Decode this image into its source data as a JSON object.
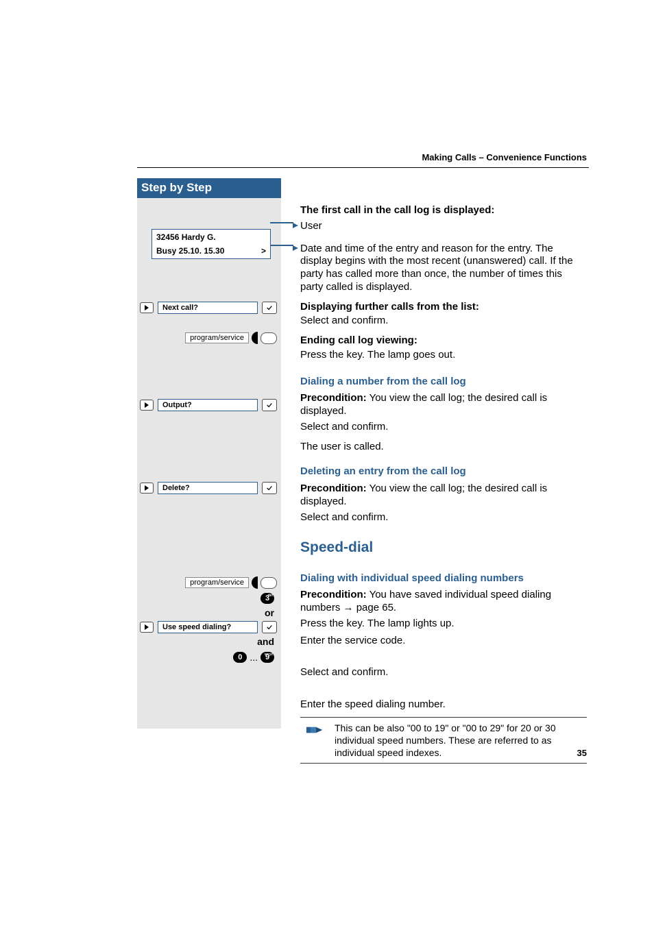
{
  "header": {
    "title": "Making Calls – Convenience Functions"
  },
  "sidebar": {
    "header": "Step by Step",
    "display": {
      "line1": "32456 Hardy G.",
      "line2_left": "Busy 25.10. 15.30",
      "line2_right": ">"
    },
    "rows": {
      "next_call": "Next call?",
      "output": "Output?",
      "delete": "Delete?",
      "use_speed_dialing": "Use speed dialing?",
      "program_service": "program/service",
      "or": "or",
      "and": "and",
      "key3": "3",
      "key3_super": "def",
      "key0": "0",
      "ellipsis": "...",
      "key9": "9",
      "key9_super": "wxyz"
    }
  },
  "main": {
    "first_call_heading": "The first call in the call log is displayed:",
    "user_label": "User",
    "entry_desc": "Date and time of the entry and reason for the entry. The display begins with the most recent (unanswered) call. If the party has called more than once, the number of times this party called is displayed.",
    "further_heading": "Displaying further calls from the list:",
    "select_confirm": "Select and confirm.",
    "end_heading": "Ending call log viewing:",
    "press_key_out": "Press the key. The lamp goes out.",
    "dial_from_log": "Dialing a number from the call log",
    "precond_label": "Precondition:",
    "precond_view": " You view the call log; the desired call is displayed.",
    "user_called": "The user is called.",
    "del_from_log": "Deleting an entry from the call log",
    "speed_dial": "Speed-dial",
    "dial_indiv": "Dialing with individual speed dialing numbers",
    "precond_saved_a": " You have saved individual speed dialing numbers ",
    "precond_saved_arrow": "→",
    "precond_saved_b": " page 65.",
    "press_key_up": "Press the key. The lamp lights up.",
    "enter_code": "Enter the service code.",
    "enter_speed_num": "Enter the speed dialing number.",
    "note": "This can be also \"00 to 19\" or \"00 to 29\" for 20 or 30 individual speed numbers. These are referred to as individual speed indexes."
  },
  "page_number": "35"
}
